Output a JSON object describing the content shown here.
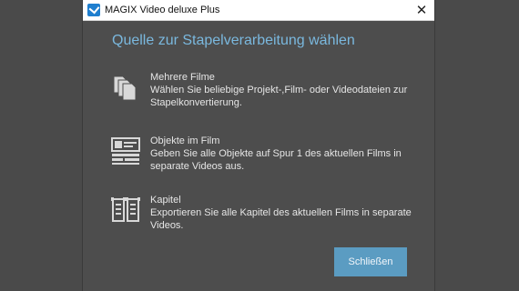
{
  "window": {
    "title": "MAGIX Video deluxe Plus",
    "close_glyph": "✕"
  },
  "dialog": {
    "title": "Quelle zur Stapelverarbeitung wählen",
    "options": [
      {
        "icon": "multiple-files-icon",
        "title": "Mehrere Filme",
        "description": "Wählen Sie beliebige Projekt-,Film- oder Videodateien zur Stapelkonvertierung."
      },
      {
        "icon": "film-objects-icon",
        "title": "Objekte im Film",
        "description": "Geben Sie alle Objekte auf Spur 1 des aktuellen Films in separate Videos aus."
      },
      {
        "icon": "chapters-icon",
        "title": "Kapitel",
        "description": "Exportieren Sie alle Kapitel des aktuellen Films in separate Videos."
      }
    ],
    "close_button": "Schließen"
  },
  "colors": {
    "background": "#4a4a4a",
    "title_accent": "#7ab8de",
    "button": "#5b9cc2",
    "text": "#e6e6e6"
  }
}
